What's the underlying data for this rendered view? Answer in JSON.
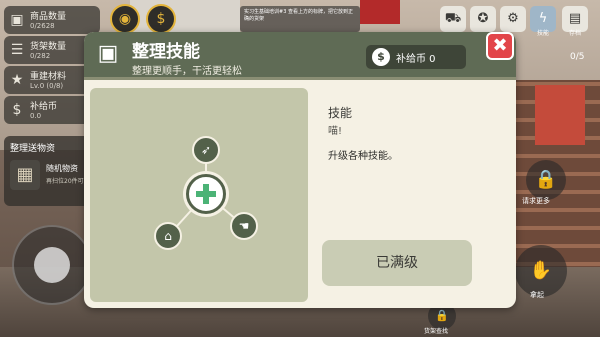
{
  "hud": {
    "stats": [
      {
        "label": "商品数量",
        "value": "0/2628",
        "icon": "box-icon"
      },
      {
        "label": "货架数量",
        "value": "0/282",
        "icon": "shelf-icon"
      },
      {
        "label": "重建材料",
        "value": "Lv.0 (0/8)",
        "icon": "star-icon"
      },
      {
        "label": "补给币",
        "value": "0.0",
        "icon": "dollar-icon"
      }
    ],
    "restock": {
      "title": "整理送物资",
      "item_name": "随机物资",
      "item_sub": "再扫位20件可"
    },
    "tip": "实习生基础培训#3 查看上方的标牌，把它放到正确的货架",
    "counter": "0/5",
    "toolbar": [
      {
        "icon": "car-icon",
        "caption": ""
      },
      {
        "icon": "badge-icon",
        "caption": ""
      },
      {
        "icon": "gear-icon",
        "caption": ""
      },
      {
        "icon": "lightning-icon",
        "caption": "技能"
      },
      {
        "icon": "save-icon",
        "caption": "存档"
      }
    ],
    "lock_caption": "请求更多",
    "pickup_caption": "拿起",
    "find_caption": "货架查找"
  },
  "modal": {
    "title": "整理技能",
    "subtitle": "整理更顺手，干活更轻松",
    "coin_label": "补给币 0",
    "close_glyph": "✖",
    "skill": {
      "name": "技能",
      "flavor": "喵!",
      "description": "升级各种技能。",
      "status_button": "已满级"
    }
  },
  "colors": {
    "header_green": "#5f6b55",
    "panel_bg": "#f5f1e4",
    "tree_bg": "#c3c6aa",
    "close_red": "#e2454a",
    "cross_green": "#4bb376"
  }
}
